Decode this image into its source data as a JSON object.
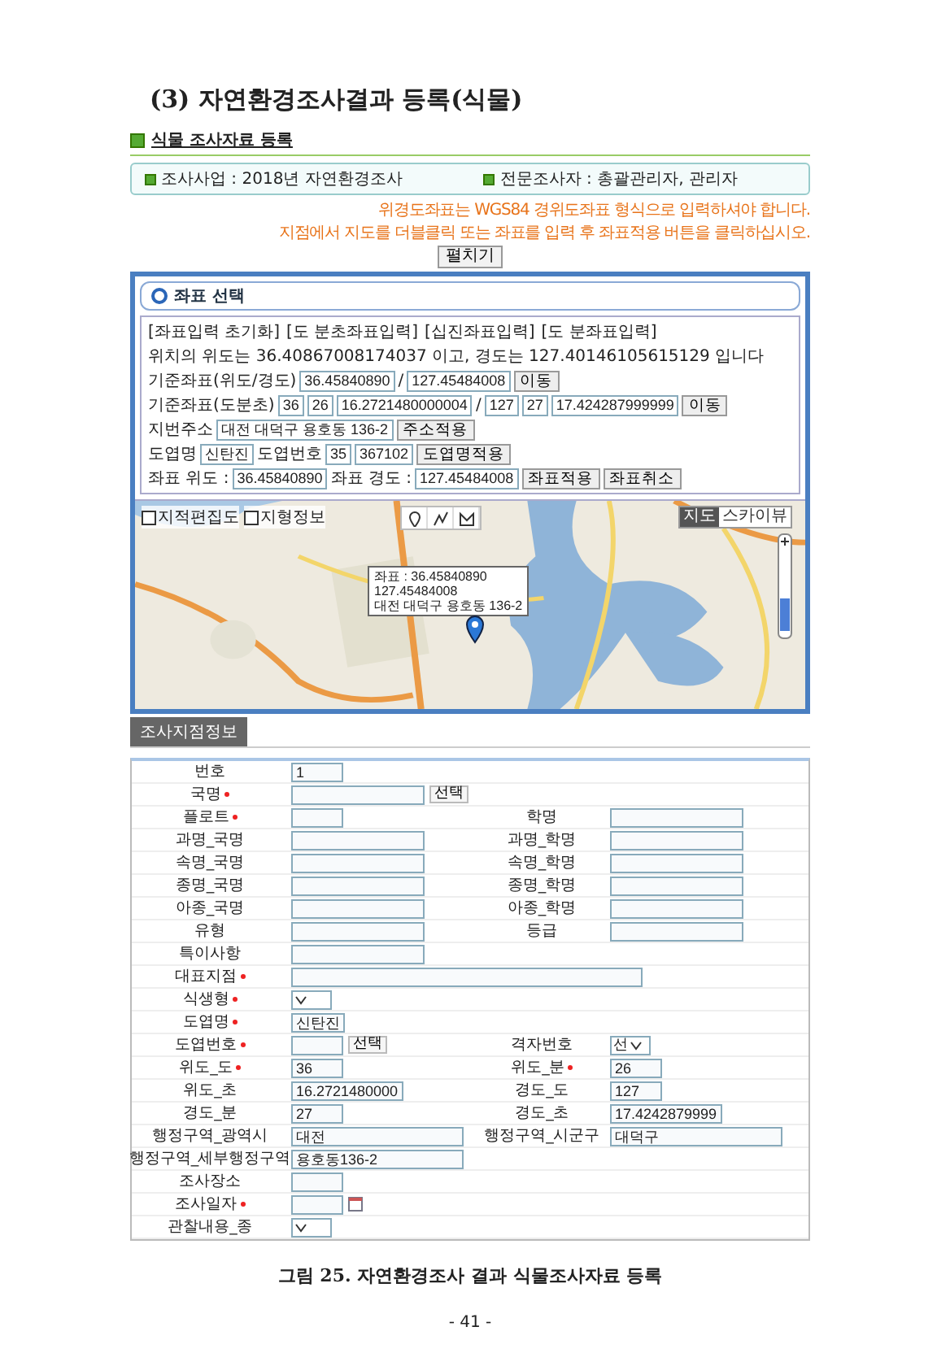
{
  "heading": "(3) 자연환경조사결과 등록(식물)",
  "app": {
    "section_title": "식물 조사자료 등록",
    "info": [
      "조사사업 : 2018년 자연환경조사",
      "전문조사자 : 총괄관리자, 관리자"
    ],
    "notes": [
      "위경도좌표는 WGS84 경위도좌표 형식으로 입력하셔야 합니다.",
      "지점에서 지도를 더블클릭 또는 좌표를 입력 후 좌표적용 버튼을 클릭하십시오."
    ],
    "toggle_button": "펼치기",
    "coordinate_panel": {
      "title": "좌표 선택",
      "links": [
        "[좌표입력 초기화]",
        "[도 분초좌표입력]",
        "[십진좌표입력]",
        "[도 분좌표입력]"
      ],
      "description": "위치의 위도는 36.40867008174037 이고, 경도는 127.40146105615129 입니다",
      "rows": [
        {
          "controls": [
            {
              "kind": "label",
              "text": "기준좌표(위도/경도)"
            },
            {
              "kind": "input",
              "value": "36.45840890"
            },
            {
              "kind": "label",
              "text": "/"
            },
            {
              "kind": "input",
              "value": "127.45484008"
            },
            {
              "kind": "button",
              "text": "이동"
            }
          ]
        },
        {
          "controls": [
            {
              "kind": "label",
              "text": "기준좌표(도분초)"
            },
            {
              "kind": "input",
              "value": "36"
            },
            {
              "kind": "input",
              "value": "26"
            },
            {
              "kind": "input",
              "value": "16.2721480000004"
            },
            {
              "kind": "label",
              "text": "/"
            },
            {
              "kind": "input",
              "value": "127"
            },
            {
              "kind": "input",
              "value": "27"
            },
            {
              "kind": "input",
              "value": "17.424287999999"
            },
            {
              "kind": "button",
              "text": "이동"
            }
          ]
        },
        {
          "controls": [
            {
              "kind": "label",
              "text": "지번주소"
            },
            {
              "kind": "input",
              "value": "대전 대덕구 용호동 136-2"
            },
            {
              "kind": "button",
              "text": "주소적용"
            }
          ]
        },
        {
          "controls": [
            {
              "kind": "label",
              "text": "도엽명"
            },
            {
              "kind": "input",
              "value": "신탄진"
            },
            {
              "kind": "label",
              "text": "도엽번호"
            },
            {
              "kind": "input",
              "value": "35"
            },
            {
              "kind": "input",
              "value": "367102"
            },
            {
              "kind": "button",
              "text": "도엽명적용"
            }
          ]
        },
        {
          "controls": [
            {
              "kind": "label",
              "text": "좌표 위도 :"
            },
            {
              "kind": "input",
              "value": "36.45840890"
            },
            {
              "kind": "label",
              "text": "좌표 경도 :"
            },
            {
              "kind": "input",
              "value": "127.45484008"
            },
            {
              "kind": "button",
              "text": "좌표적용"
            },
            {
              "kind": "button",
              "text": "좌표취소"
            }
          ]
        }
      ]
    },
    "map": {
      "zoom": {
        "level": 0.4
      },
      "layers": [
        {
          "label": "지적편집도",
          "checked": false
        },
        {
          "label": "지형정보",
          "checked": false
        }
      ],
      "views": [
        {
          "label": "지도",
          "selected": true
        },
        {
          "label": "스카이뷰",
          "selected": false
        }
      ],
      "popup": [
        "좌표 : 36.45840890",
        "127.45484008",
        "대전 대덕구 용호동 136-2"
      ]
    },
    "tab": {
      "label": "조사지점정보",
      "selected": true
    },
    "form": [
      {
        "cells": [
          {
            "label": "번호",
            "required": false,
            "field": {
              "kind": "code",
              "value": "1"
            }
          }
        ]
      },
      {
        "cells": [
          {
            "label": "국명",
            "required": true,
            "field": {
              "kind": "text"
            },
            "button": "선택"
          }
        ]
      },
      {
        "cells": [
          {
            "label": "플로트",
            "required": true,
            "field": {
              "kind": "code"
            }
          },
          {
            "label": "학명",
            "required": false,
            "field": {
              "kind": "text"
            }
          }
        ]
      },
      {
        "cells": [
          {
            "label": "과명_국명",
            "required": false,
            "field": {
              "kind": "text"
            }
          },
          {
            "label": "과명_학명",
            "required": false,
            "field": {
              "kind": "text"
            }
          }
        ]
      },
      {
        "cells": [
          {
            "label": "속명_국명",
            "required": false,
            "field": {
              "kind": "text"
            }
          },
          {
            "label": "속명_학명",
            "required": false,
            "field": {
              "kind": "text"
            }
          }
        ]
      },
      {
        "cells": [
          {
            "label": "종명_국명",
            "required": false,
            "field": {
              "kind": "text"
            }
          },
          {
            "label": "종명_학명",
            "required": false,
            "field": {
              "kind": "text"
            }
          }
        ]
      },
      {
        "cells": [
          {
            "label": "아종_국명",
            "required": false,
            "field": {
              "kind": "text"
            }
          },
          {
            "label": "아종_학명",
            "required": false,
            "field": {
              "kind": "text"
            }
          }
        ]
      },
      {
        "cells": [
          {
            "label": "유형",
            "required": false,
            "field": {
              "kind": "text"
            }
          },
          {
            "label": "등급",
            "required": false,
            "field": {
              "kind": "text"
            }
          }
        ]
      },
      {
        "cells": [
          {
            "label": "특이사항",
            "required": false,
            "field": {
              "kind": "text"
            }
          }
        ]
      },
      {
        "cells": [
          {
            "label": "대표지점",
            "required": true,
            "field": {
              "kind": "note"
            }
          }
        ]
      },
      {
        "cells": [
          {
            "label": "식생형",
            "required": true,
            "field": {
              "kind": "select"
            }
          }
        ]
      },
      {
        "cells": [
          {
            "label": "도엽명",
            "required": true,
            "field": {
              "kind": "code",
              "value": "신탄진"
            }
          }
        ]
      },
      {
        "cells": [
          {
            "label": "도엽번호",
            "required": true,
            "field": {
              "kind": "code"
            },
            "button": "선택"
          },
          {
            "label": "격자번호",
            "required": false,
            "field": {
              "kind": "select",
              "value": "선"
            }
          }
        ]
      },
      {
        "cells": [
          {
            "label": "위도_도",
            "required": true,
            "field": {
              "kind": "code",
              "value": "36"
            }
          },
          {
            "label": "위도_분",
            "required": true,
            "field": {
              "kind": "code",
              "value": "26"
            }
          }
        ]
      },
      {
        "cells": [
          {
            "label": "위도_초",
            "required": false,
            "field": {
              "kind": "code",
              "value": "16.2721480000"
            }
          },
          {
            "label": "경도_도",
            "required": false,
            "field": {
              "kind": "code",
              "value": "127"
            }
          }
        ]
      },
      {
        "cells": [
          {
            "label": "경도_분",
            "required": false,
            "field": {
              "kind": "code",
              "value": "27"
            }
          },
          {
            "label": "경도_초",
            "required": false,
            "field": {
              "kind": "code",
              "value": "17.4242879999"
            }
          }
        ]
      },
      {
        "cells": [
          {
            "label": "행정구역_광역시",
            "required": false,
            "field": {
              "kind": "address",
              "value": "대전"
            }
          },
          {
            "label": "행정구역_시군구",
            "required": false,
            "field": {
              "kind": "address",
              "value": "대덕구"
            }
          }
        ]
      },
      {
        "cells": [
          {
            "label": "행정구역_세부행정구역",
            "required": false,
            "field": {
              "kind": "address",
              "value": "용호동136-2"
            }
          }
        ]
      },
      {
        "cells": [
          {
            "label": "조사장소",
            "required": false,
            "field": {
              "kind": "code"
            }
          }
        ]
      },
      {
        "cells": [
          {
            "label": "조사일자",
            "required": true,
            "field": {
              "kind": "date"
            }
          }
        ]
      },
      {
        "cells": [
          {
            "label": "관찰내용_종",
            "required": false,
            "field": {
              "kind": "select"
            }
          }
        ]
      }
    ]
  },
  "caption": "그림 25. 자연환경조사 결과 식물조사자료 등록",
  "page_number": "- 41 -"
}
